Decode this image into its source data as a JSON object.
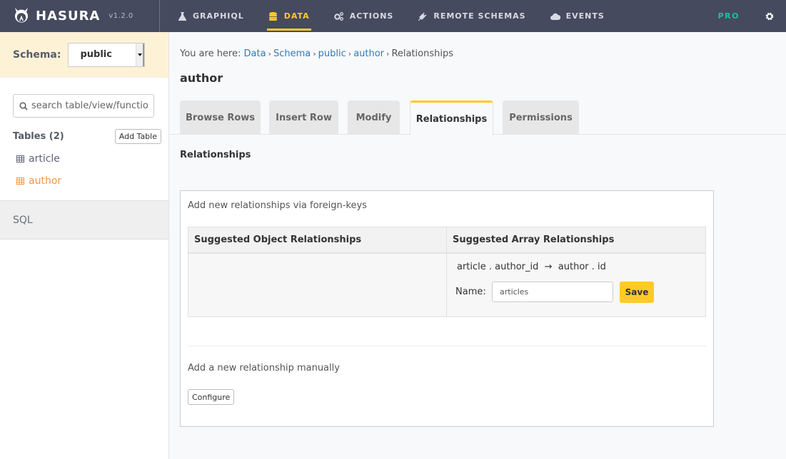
{
  "header": {
    "brand": "HASURA",
    "version": "v1.2.0",
    "nav": [
      {
        "label": "GRAPHIQL",
        "icon": "flask-icon",
        "active": false
      },
      {
        "label": "DATA",
        "icon": "database-icon",
        "active": true
      },
      {
        "label": "ACTIONS",
        "icon": "cogs-icon",
        "active": false
      },
      {
        "label": "REMOTE SCHEMAS",
        "icon": "plug-icon",
        "active": false
      },
      {
        "label": "EVENTS",
        "icon": "cloud-icon",
        "active": false
      }
    ],
    "pro_label": "PRO",
    "settings_icon": "gear-icon"
  },
  "sidebar": {
    "schema_label": "Schema:",
    "schema_value": "public",
    "search_placeholder": "search table/view/functio",
    "tables_title": "Tables (2)",
    "add_table_label": "Add Table",
    "tables": [
      {
        "name": "article",
        "active": false
      },
      {
        "name": "author",
        "active": true
      }
    ],
    "sql_label": "SQL"
  },
  "main": {
    "breadcrumb": {
      "prefix": "You are here:",
      "items": [
        "Data",
        "Schema",
        "public",
        "author"
      ],
      "current": "Relationships",
      "separator": "›"
    },
    "title": "author",
    "tabs": [
      {
        "label": "Browse Rows",
        "active": false
      },
      {
        "label": "Insert Row",
        "active": false
      },
      {
        "label": "Modify",
        "active": false
      },
      {
        "label": "Relationships",
        "active": true
      },
      {
        "label": "Permissions",
        "active": false
      }
    ],
    "section_title": "Relationships",
    "card": {
      "subtitle": "Add new relationships via foreign-keys",
      "object_header": "Suggested Object Relationships",
      "array_header": "Suggested Array Relationships",
      "array_suggestion": {
        "mapping": "article . author_id  →  author . id",
        "name_label": "Name:",
        "name_value": "articles",
        "save_label": "Save"
      },
      "manual_text": "Add a new relationship manually",
      "configure_label": "Configure"
    }
  },
  "colors": {
    "nav_bg": "#454a5f",
    "accent": "#ffca27",
    "pro": "#1ebea5",
    "active_table": "#f7973f",
    "link": "#337ab7",
    "schema_bar": "#fdf2d6"
  }
}
